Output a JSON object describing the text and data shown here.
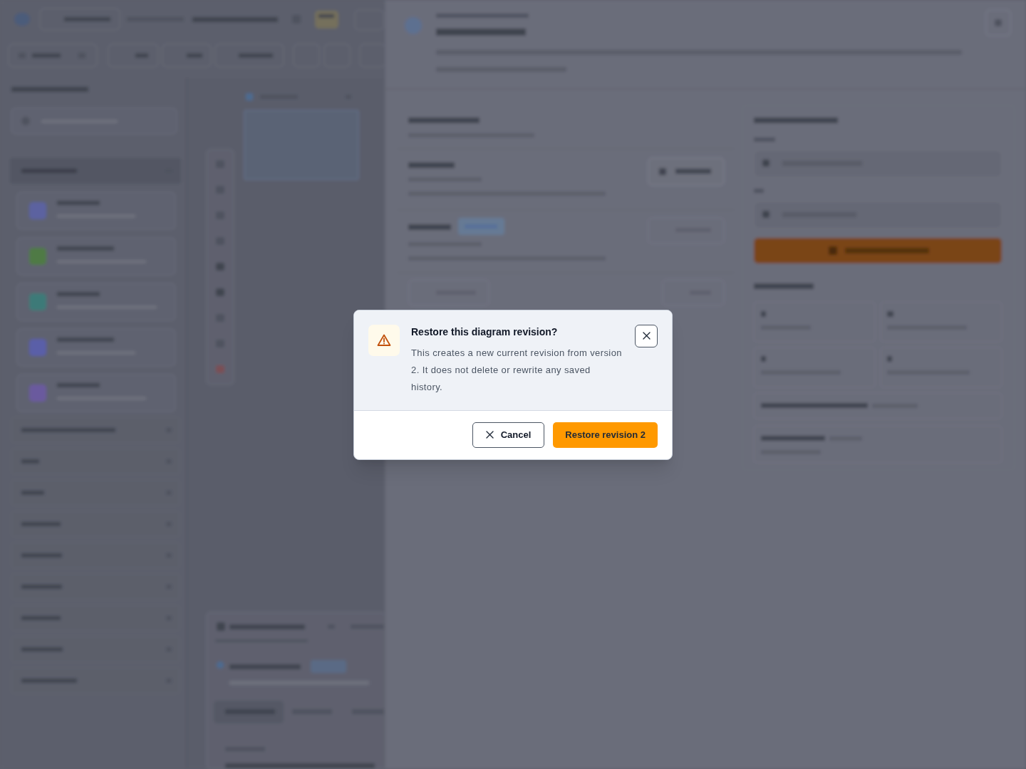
{
  "dialog": {
    "title": "Restore this diagram revision?",
    "message": "This creates a new current revision from version 2. It does not delete or rewrite any saved history.",
    "buttons": [
      {
        "label": "Cancel",
        "kind": "secondary"
      },
      {
        "label": "Restore revision 2",
        "kind": "primary"
      }
    ]
  }
}
